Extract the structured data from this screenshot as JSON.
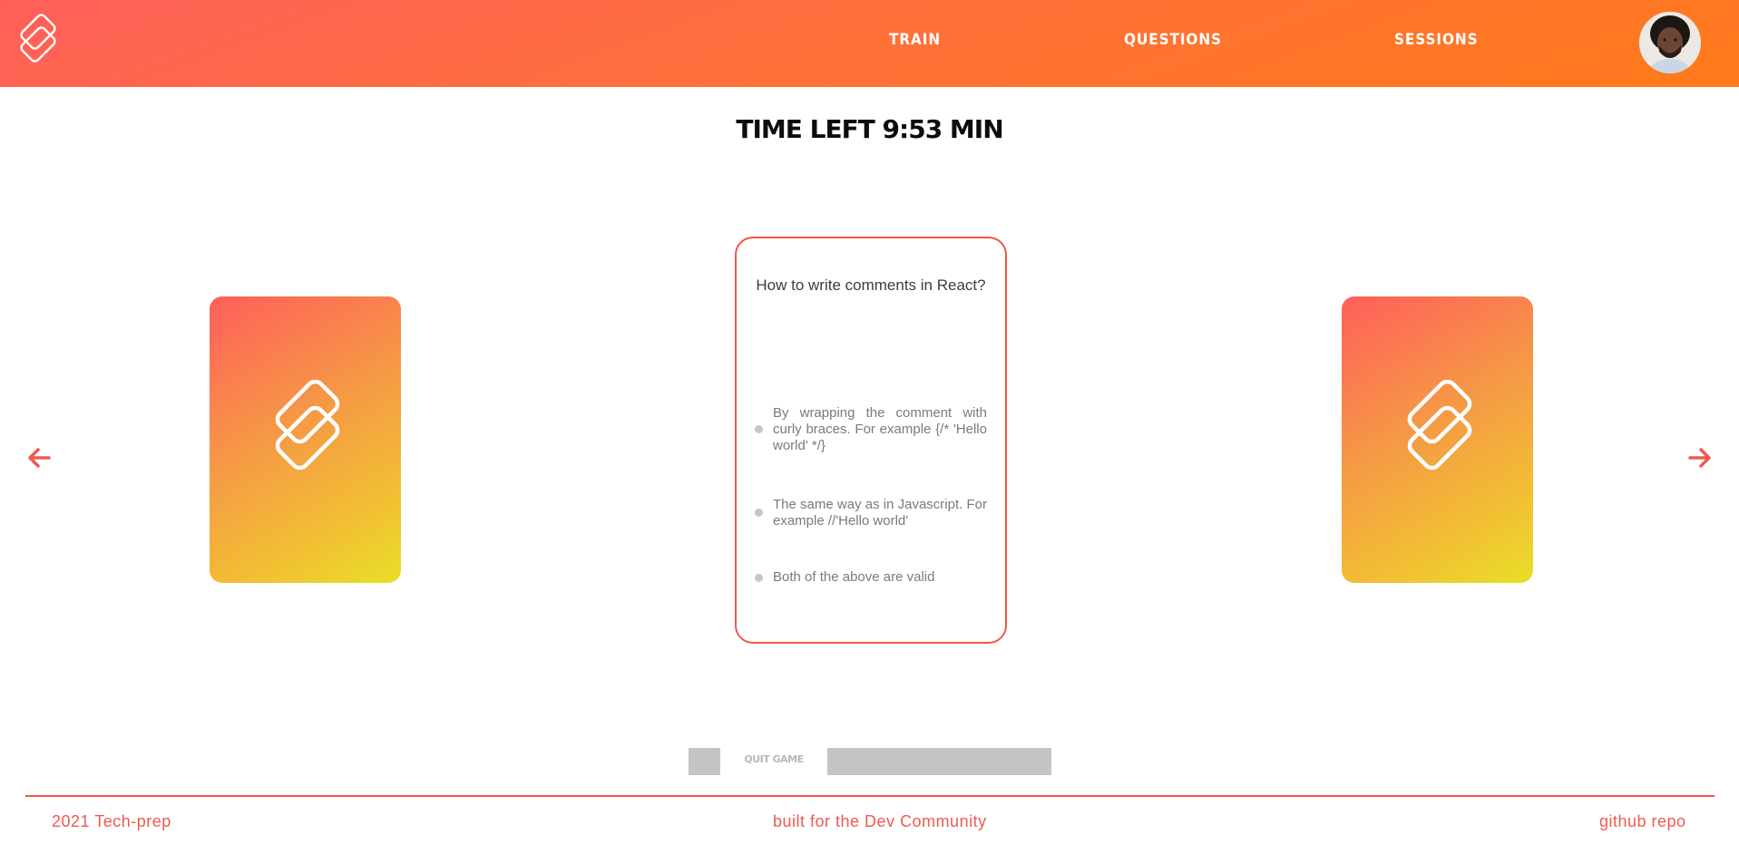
{
  "nav": {
    "items": [
      {
        "label": "TRAIN"
      },
      {
        "label": "QUESTIONS"
      },
      {
        "label": "SESSIONS"
      }
    ]
  },
  "timer": {
    "text": "TIME LEFT 9:53 MIN"
  },
  "question": {
    "title": "How to write comments in React?",
    "options": [
      {
        "text": "By wrapping the comment with curly braces. For example {/* 'Hello world' */}"
      },
      {
        "text": "The same way as in Javascript. For example //'Hello world'"
      },
      {
        "text": "Both of the above are valid"
      }
    ]
  },
  "controls": {
    "quit_label": "QUIT GAME"
  },
  "footer": {
    "left": "2021 Tech-prep",
    "center": "built for the Dev Community",
    "right": "github repo"
  },
  "colors": {
    "accent": "#f0574a",
    "header_start": "#ff5f5a",
    "header_end": "#ff7a1a",
    "card_gradient_end": "#e7e027"
  },
  "icons": {
    "logo": "stacked-cards-logo-icon",
    "prev": "arrow-left-icon",
    "next": "arrow-right-icon"
  }
}
